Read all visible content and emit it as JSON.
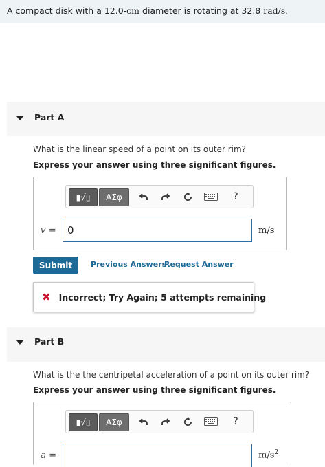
{
  "problem": {
    "text_prefix": "A compact disk with a 12.0-",
    "diameter_unit": "cm",
    "text_middle": " diameter is rotating at 32.8 ",
    "rate_unit": "rad/s",
    "text_suffix": "."
  },
  "part_a": {
    "title": "Part A",
    "question": "What is the linear speed of a point on its outer rim?",
    "instruction": "Express your answer using three significant figures.",
    "toolbar": {
      "template_btn": "▮√▯",
      "greek_btn": "ΑΣφ",
      "undo_icon": "undo-icon",
      "redo_icon": "redo-icon",
      "reset_icon": "reset-icon",
      "keyboard_icon": "keyboard-icon",
      "help_label": "?"
    },
    "variable": "v =",
    "input_value": "0",
    "unit": "m/s",
    "submit_label": "Submit",
    "previous_answers_label": "Previous Answers",
    "request_answer_label": "Request Answer",
    "feedback": {
      "icon": "✖",
      "text": "Incorrect; Try Again; 5 attempts remaining"
    }
  },
  "part_b": {
    "title": "Part B",
    "question": "What is the the centripetal acceleration of a point on its outer rim?",
    "instruction": "Express your answer using three significant figures.",
    "toolbar": {
      "template_btn": "▮√▯",
      "greek_btn": "ΑΣφ",
      "help_label": "?"
    },
    "variable": "a =",
    "input_value": "",
    "unit_base": "m/s",
    "unit_exp": "2"
  }
}
